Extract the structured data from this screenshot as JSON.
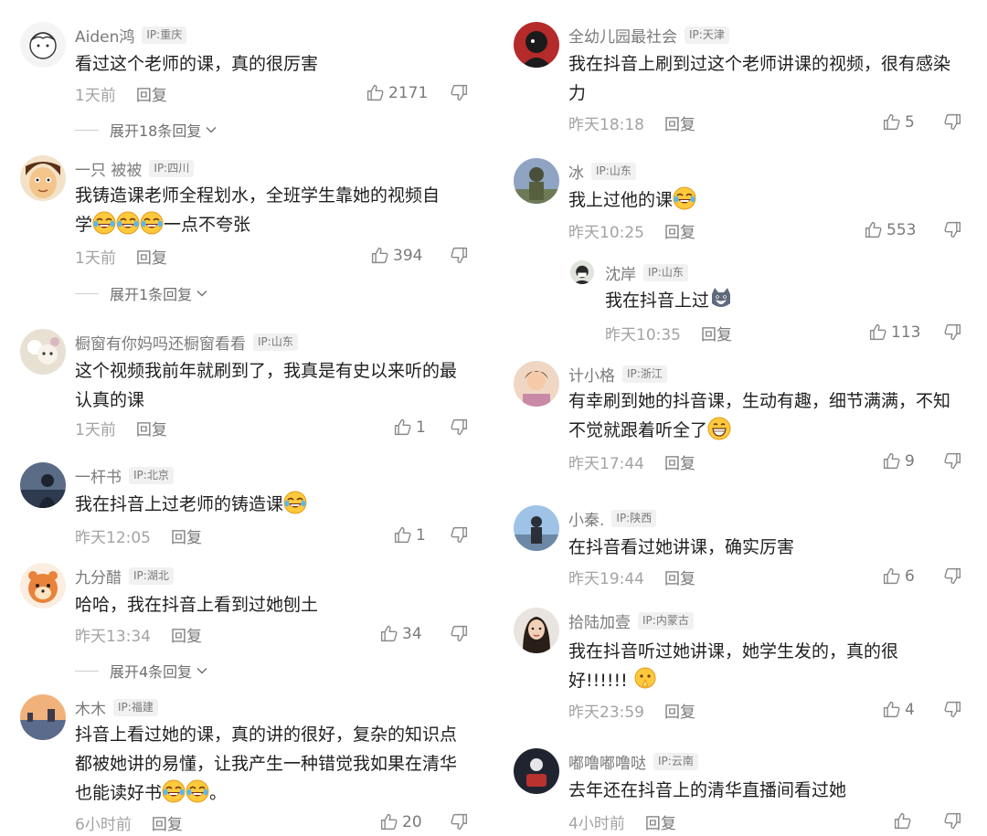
{
  "reply_label": "回复",
  "comments": [
    {
      "user": "Aiden鸿",
      "ip": "IP:重庆",
      "text": "看过这个老师的课，真的很厉害",
      "time": "1天前",
      "likes": "2171",
      "expand": "展开18条回复"
    },
    {
      "user": "一只 被被",
      "ip": "IP:四川",
      "text_line1": "我铸造课老师全程划水，全班学生靠她的视频自",
      "text_pre": "学",
      "text_post": "一点不夸张",
      "time": "1天前",
      "likes": "394",
      "expand": "展开1条回复"
    },
    {
      "user": "橱窗有你妈吗还橱窗看看",
      "ip": "IP:山东",
      "text": "这个视频我前年就刷到了，我真是有史以来听的最认真的课",
      "time": "1天前",
      "likes": "1"
    },
    {
      "user": "一杆书",
      "ip": "IP:北京",
      "text": "我在抖音上过老师的铸造课",
      "time": "昨天12:05",
      "likes": "1"
    },
    {
      "user": "九分醋",
      "ip": "IP:湖北",
      "text": "哈哈，我在抖音上看到过她刨土",
      "time": "昨天13:34",
      "likes": "34",
      "expand": "展开4条回复"
    },
    {
      "user": "木木",
      "ip": "IP:福建",
      "text": "抖音上看过她的课，真的讲的很好，复杂的知识点都被她讲的易懂，让我产生一种错觉我如果在清华也能读好书",
      "text_tail": "。",
      "time": "6小时前",
      "likes": "20"
    },
    {
      "user": "全幼儿园最社会",
      "ip": "IP:天津",
      "text": "我在抖音上刷到过这个老师讲课的视频，很有感染力",
      "time": "昨天18:18",
      "likes": "5"
    },
    {
      "user": "冰",
      "ip": "IP:山东",
      "text": "我上过他的课",
      "time": "昨天10:25",
      "likes": "553"
    },
    {
      "user": "沈岸",
      "ip": "IP:山东",
      "text": "我在抖音上过",
      "time": "昨天10:35",
      "likes": "113"
    },
    {
      "user": "计小格",
      "ip": "IP:浙江",
      "text": "有幸刷到她的抖音课，生动有趣，细节满满，不知不觉就跟着听全了",
      "time": "昨天17:44",
      "likes": "9"
    },
    {
      "user": "小秦.",
      "ip": "IP:陕西",
      "text": "在抖音看过她讲课，确实厉害",
      "time": "昨天19:44",
      "likes": "6"
    },
    {
      "user": "拾陆加壹",
      "ip": "IP:内蒙古",
      "text_line1": "我在抖音听过她讲课，她学生发的，真的很",
      "text_pre": "好!!!!!! ",
      "time": "昨天23:59",
      "likes": "4"
    },
    {
      "user": "嘟噜嘟噜哒",
      "ip": "IP:云南",
      "text": "去年还在抖音上的清华直播间看过她",
      "time": "4小时前",
      "likes": ""
    }
  ]
}
